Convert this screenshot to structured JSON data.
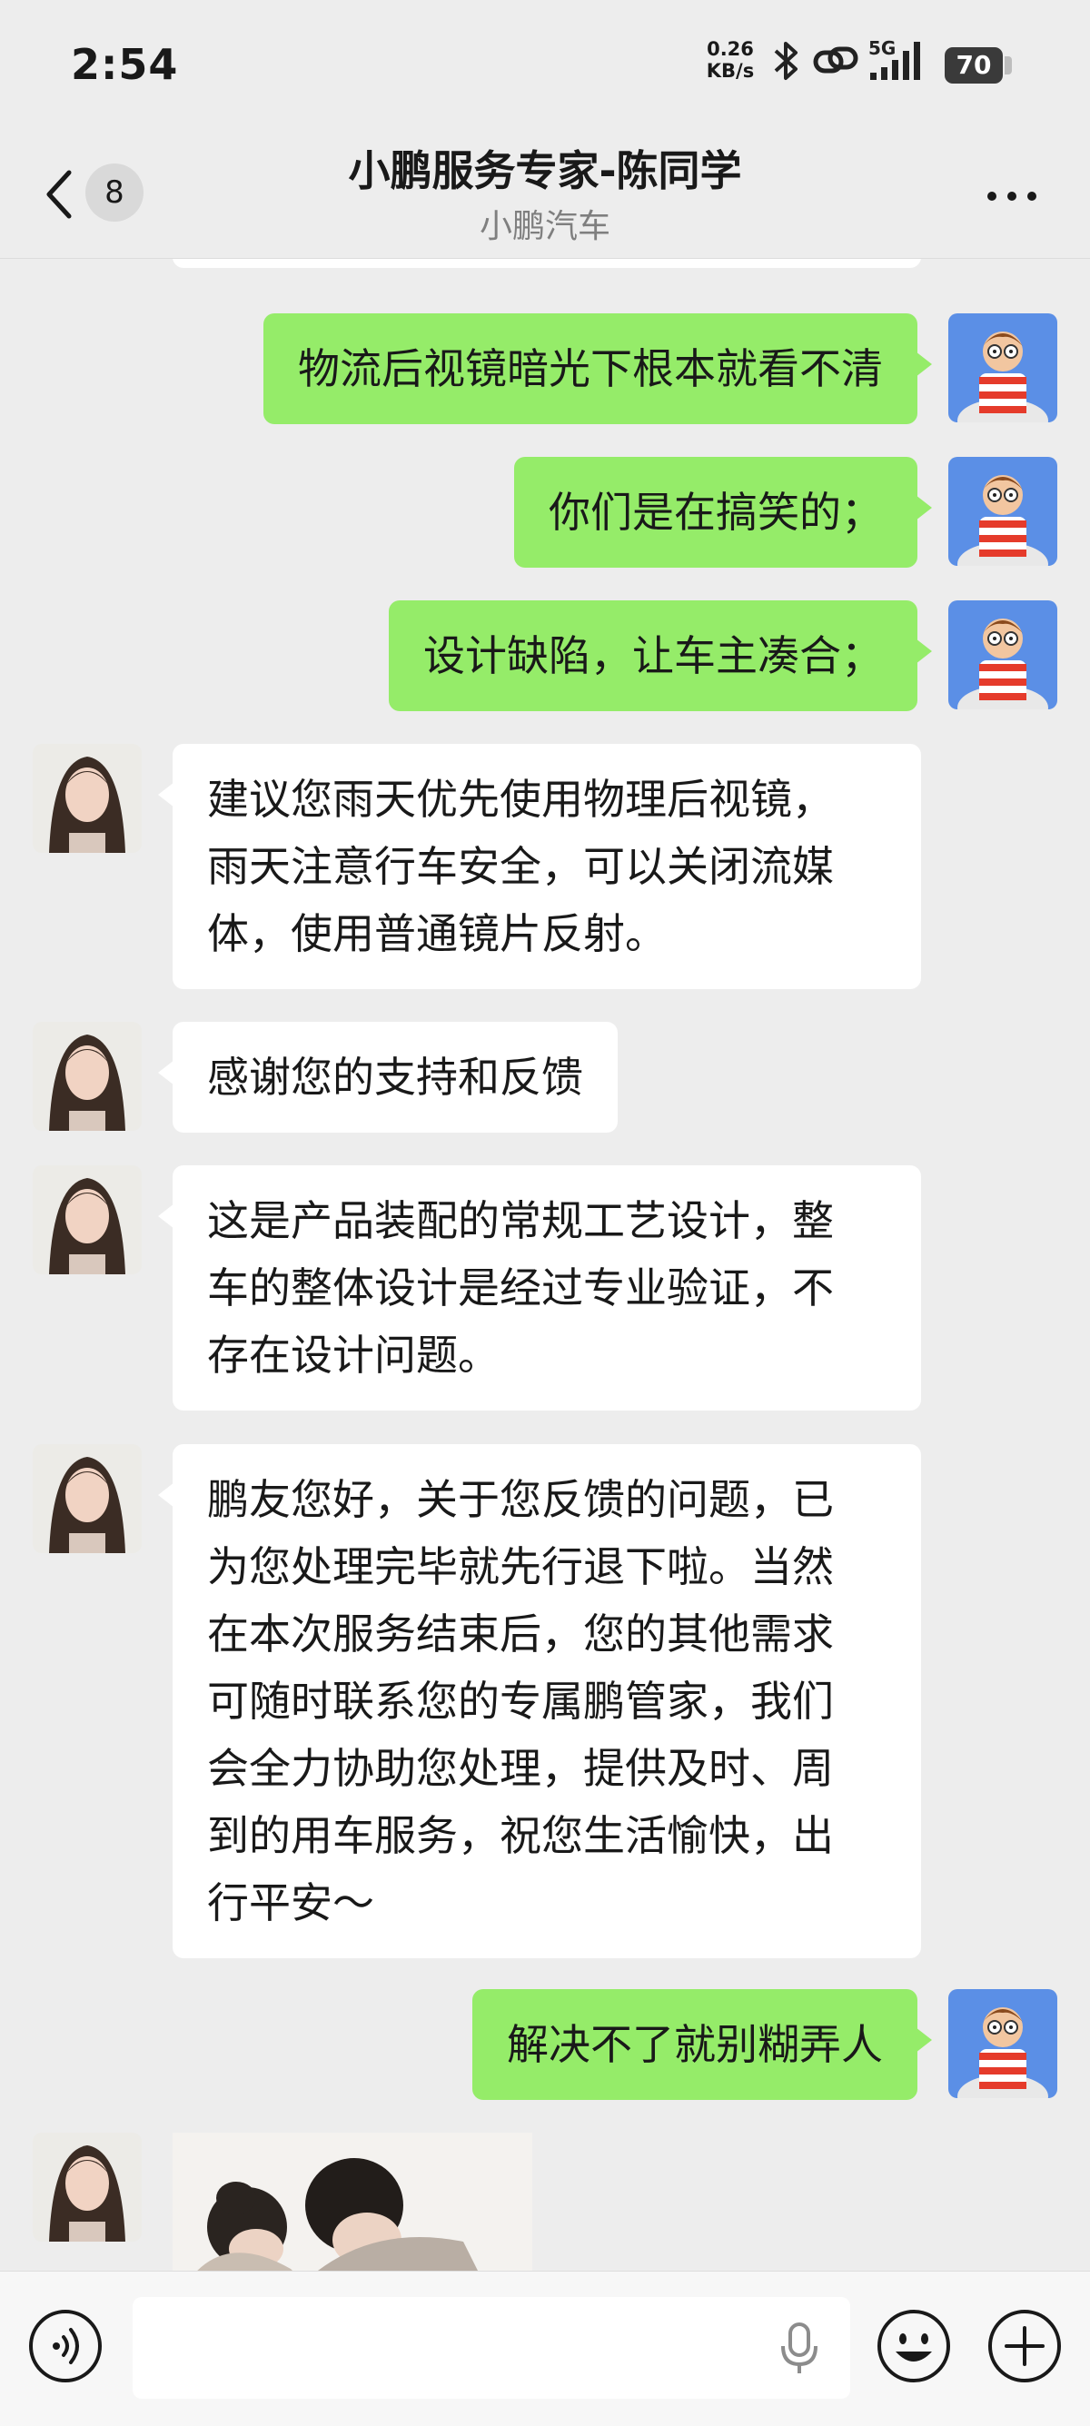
{
  "status_bar": {
    "time": "2:54",
    "net_speed_value": "0.26",
    "net_speed_unit": "KB/s",
    "network_type": "5G",
    "battery": "70"
  },
  "header": {
    "back_count": "8",
    "title": "小鹏服务专家-陈同学",
    "subtitle": "小鹏汽车"
  },
  "messages": [
    {
      "sender": "me",
      "text": "物流后视镜暗光下根本就看不清"
    },
    {
      "sender": "me",
      "text": "你们是在搞笑的；"
    },
    {
      "sender": "me",
      "text": "设计缺陷，让车主凑合；"
    },
    {
      "sender": "agent",
      "text": "建议您雨天优先使用物理后视镜，\n雨天注意行车安全，可以关闭流媒\n体，使用普通镜片反射。"
    },
    {
      "sender": "agent",
      "text": "感谢您的支持和反馈"
    },
    {
      "sender": "agent",
      "text": "这是产品装配的常规工艺设计，整\n车的整体设计是经过专业验证，不\n存在设计问题。"
    },
    {
      "sender": "agent",
      "text": "鹏友您好，关于您反馈的问题，已\n为您处理完毕就先行退下啦。当然\n在本次服务结束后，您的其他需求\n可随时联系您的专属鹏管家，我们\n会全力协助您处理，提供及时、周\n到的用车服务，祝您生活愉快，出\n行平安～"
    },
    {
      "sender": "me",
      "text": "解决不了就别糊弄人"
    },
    {
      "sender": "agent",
      "type": "image"
    }
  ],
  "colors": {
    "my_bubble": "#95ec69",
    "agent_bubble": "#ffffff",
    "background": "#ededed"
  }
}
